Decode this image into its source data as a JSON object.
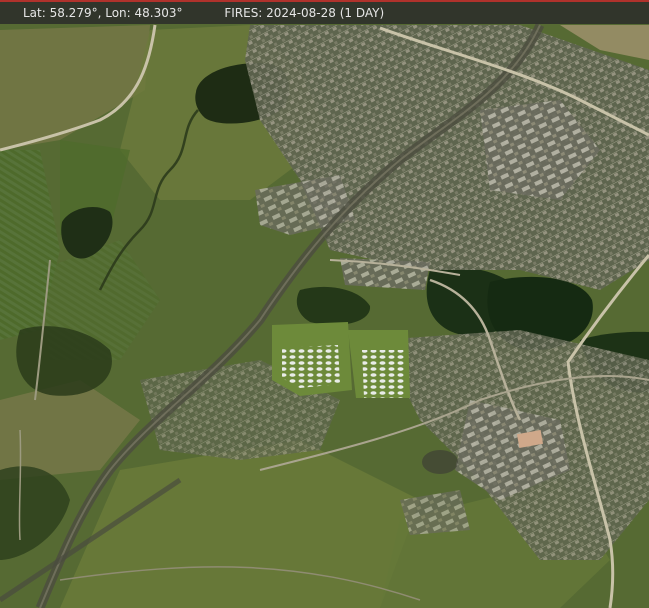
{
  "header": {
    "coords_text": "Lat: 58.279°, Lon: 48.303°",
    "fires_text": "FIRES: 2024-08-28 (1 DAY)"
  },
  "map": {
    "layer": "satellite-imagery",
    "colors": {
      "accent_line": "#b0322c",
      "info_bar_bg": "#2a2a2a",
      "info_text": "#e6e6e6"
    }
  }
}
